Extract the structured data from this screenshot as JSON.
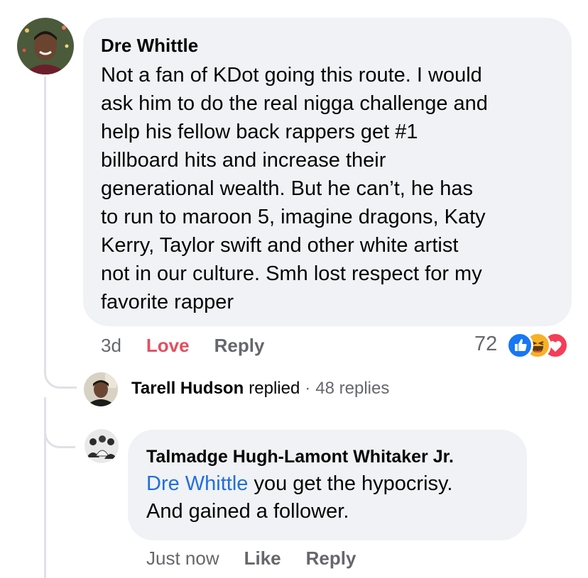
{
  "comment": {
    "author": "Dre Whittle",
    "lines": [
      "Not a fan of KDot going this route. I would",
      "ask him to do the real nigga challenge and",
      "help his fellow back rappers get #1",
      "billboard hits and increase their",
      "generational wealth. But he can’t, he has",
      "to run to maroon 5, imagine dragons, Katy",
      "Kerry, Taylor swift and other white artist",
      "not in our culture. Smh lost respect for my",
      "favorite rapper"
    ],
    "time": "3d",
    "reaction_label": "Love",
    "reply_label": "Reply",
    "reaction_count": "72",
    "reaction_icons": [
      "like-icon",
      "haha-icon",
      "love-icon"
    ],
    "colors": {
      "love": "#e34f5e",
      "like": "#1877f2",
      "haha": "#f7b125",
      "heart": "#f33e58"
    }
  },
  "replied_summary": {
    "name": "Tarell Hudson",
    "verb": "replied",
    "separator": "·",
    "count": "48 replies"
  },
  "reply": {
    "author": "Talmadge Hugh-Lamont Whitaker Jr.",
    "mention": "Dre Whittle",
    "line1_rest": " you get the hypocrisy.",
    "line2": "And gained a follower.",
    "time": "Just now",
    "like_label": "Like",
    "reply_label": "Reply"
  }
}
